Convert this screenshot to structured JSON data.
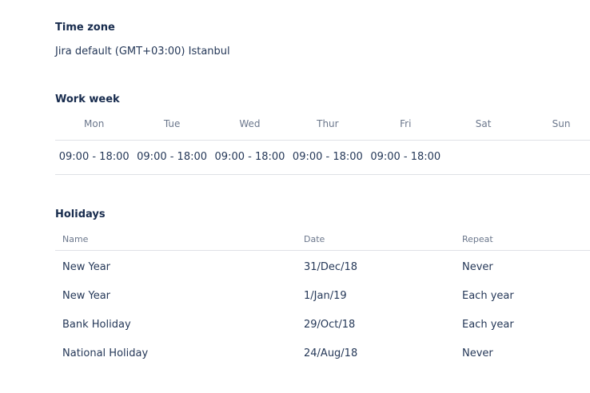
{
  "timezone": {
    "title": "Time zone",
    "value": "Jira default (GMT+03:00) Istanbul"
  },
  "work_week": {
    "title": "Work week",
    "days": [
      {
        "day": "Mon",
        "hours": "09:00 - 18:00"
      },
      {
        "day": "Tue",
        "hours": "09:00 - 18:00"
      },
      {
        "day": "Wed",
        "hours": "09:00 - 18:00"
      },
      {
        "day": "Thur",
        "hours": "09:00 - 18:00"
      },
      {
        "day": "Fri",
        "hours": "09:00 - 18:00"
      },
      {
        "day": "Sat",
        "hours": ""
      },
      {
        "day": "Sun",
        "hours": ""
      }
    ]
  },
  "holidays": {
    "title": "Holidays",
    "columns": [
      "Name",
      "Date",
      "Repeat"
    ],
    "rows": [
      {
        "name": "New Year",
        "date": "31/Dec/18",
        "repeat": "Never"
      },
      {
        "name": "New Year",
        "date": "1/Jan/19",
        "repeat": "Each year"
      },
      {
        "name": "Bank Holiday",
        "date": "29/Oct/18",
        "repeat": "Each year"
      },
      {
        "name": "National Holiday",
        "date": "24/Aug/18",
        "repeat": "Never"
      }
    ]
  }
}
